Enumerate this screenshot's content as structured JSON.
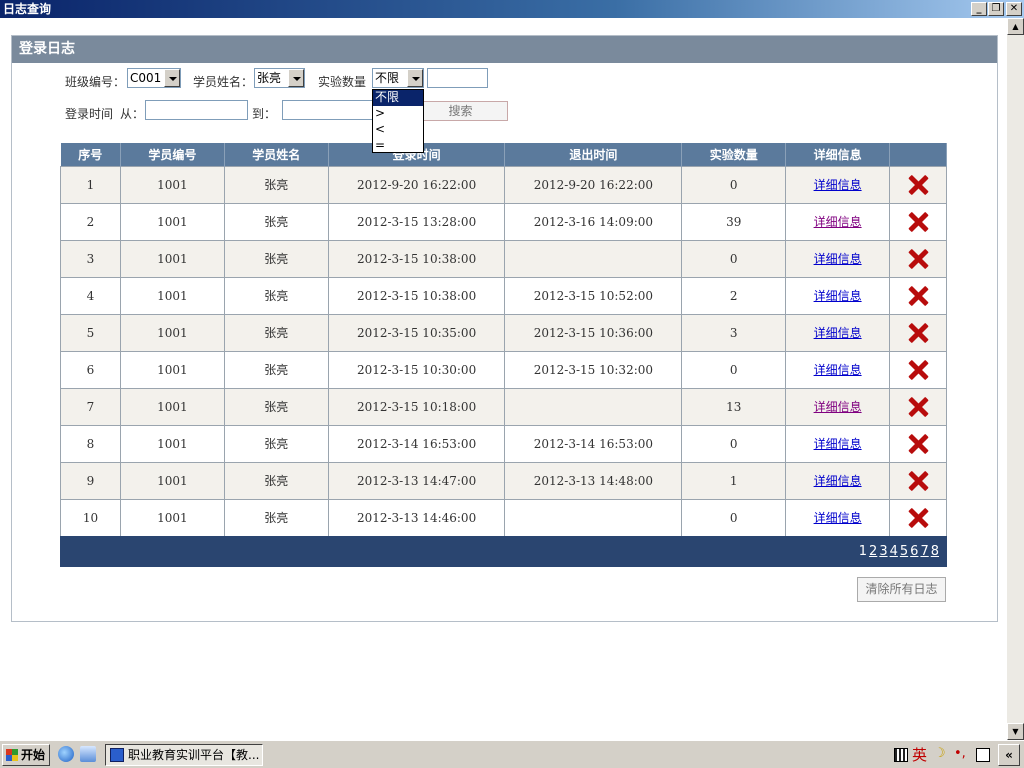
{
  "window": {
    "title": "日志查询",
    "minimize": "_",
    "restore": "❐",
    "close": "✕"
  },
  "panel": {
    "title": "登录日志"
  },
  "filters": {
    "class_label": "班级编号：",
    "class_value": "C001",
    "student_label": "学员姓名：",
    "student_value": "张亮",
    "exp_count_label": "实验数量",
    "exp_count_op": "不限",
    "exp_count_value": "",
    "login_time_label": "登录时间",
    "from_label": "从：",
    "from_value": "",
    "to_label": "到：",
    "to_value": "",
    "search_button": "搜索",
    "op_options": [
      "不限",
      ">",
      "<",
      "="
    ]
  },
  "table": {
    "headers": [
      "序号",
      "学员编号",
      "学员姓名",
      "登录时间",
      "退出时间",
      "实验数量",
      "详细信息",
      ""
    ],
    "detail_link": "详细信息",
    "rows": [
      {
        "no": "1",
        "sid": "1001",
        "name": "张亮",
        "login": "2012-9-20 16:22:00",
        "logout": "2012-9-20 16:22:00",
        "count": "0",
        "visited": false
      },
      {
        "no": "2",
        "sid": "1001",
        "name": "张亮",
        "login": "2012-3-15 13:28:00",
        "logout": "2012-3-16 14:09:00",
        "count": "39",
        "visited": true
      },
      {
        "no": "3",
        "sid": "1001",
        "name": "张亮",
        "login": "2012-3-15 10:38:00",
        "logout": "",
        "count": "0",
        "visited": false
      },
      {
        "no": "4",
        "sid": "1001",
        "name": "张亮",
        "login": "2012-3-15 10:38:00",
        "logout": "2012-3-15 10:52:00",
        "count": "2",
        "visited": false
      },
      {
        "no": "5",
        "sid": "1001",
        "name": "张亮",
        "login": "2012-3-15 10:35:00",
        "logout": "2012-3-15 10:36:00",
        "count": "3",
        "visited": false
      },
      {
        "no": "6",
        "sid": "1001",
        "name": "张亮",
        "login": "2012-3-15 10:30:00",
        "logout": "2012-3-15 10:32:00",
        "count": "0",
        "visited": false
      },
      {
        "no": "7",
        "sid": "1001",
        "name": "张亮",
        "login": "2012-3-15 10:18:00",
        "logout": "",
        "count": "13",
        "visited": true
      },
      {
        "no": "8",
        "sid": "1001",
        "name": "张亮",
        "login": "2012-3-14 16:53:00",
        "logout": "2012-3-14 16:53:00",
        "count": "0",
        "visited": false
      },
      {
        "no": "9",
        "sid": "1001",
        "name": "张亮",
        "login": "2012-3-13 14:47:00",
        "logout": "2012-3-13 14:48:00",
        "count": "1",
        "visited": false
      },
      {
        "no": "10",
        "sid": "1001",
        "name": "张亮",
        "login": "2012-3-13 14:46:00",
        "logout": "",
        "count": "0",
        "visited": false
      }
    ]
  },
  "pager": {
    "pages": [
      "1",
      "2",
      "3",
      "4",
      "5",
      "6",
      "7",
      "8"
    ],
    "current": "1"
  },
  "clear_button": "清除所有日志",
  "taskbar": {
    "start": "开始",
    "task": "职业教育实训平台【教...",
    "ime": "英",
    "expand": "«"
  },
  "colors": {
    "header": "#5b7a9c",
    "pager": "#2a4570",
    "delete": "#b80c0c",
    "link": "#0000cc"
  }
}
